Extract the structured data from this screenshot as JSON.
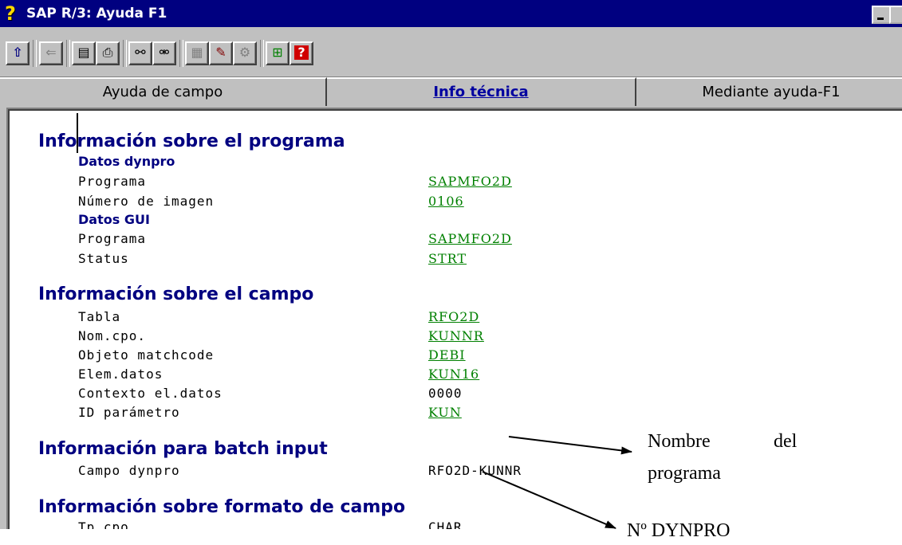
{
  "window": {
    "title": "SAP R/3: Ayuda F1"
  },
  "toolbar": {
    "buttons": [
      {
        "icon": "up-arrow-icon"
      },
      {
        "icon": "back-arrow-icon"
      },
      {
        "icon": "copy-icon"
      },
      {
        "icon": "print-icon"
      },
      {
        "icon": "find-icon"
      },
      {
        "icon": "find-next-icon"
      },
      {
        "icon": "paste-icon"
      },
      {
        "icon": "edit-icon"
      },
      {
        "icon": "settings-icon"
      },
      {
        "icon": "info-icon"
      },
      {
        "icon": "help-icon"
      }
    ]
  },
  "tabs": [
    {
      "label": "Ayuda de campo",
      "active": false
    },
    {
      "label": "Info técnica",
      "active": true
    },
    {
      "label": "Mediante ayuda-F1",
      "active": false
    }
  ],
  "program_info": {
    "title": "Información sobre el programa",
    "dynpro_title": "Datos dynpro",
    "programa_label": "Programa",
    "programa_value": "SAPMFO2D",
    "imagen_label": "Número de imagen",
    "imagen_value": "0106",
    "gui_title": "Datos GUI",
    "gui_programa_label": "Programa",
    "gui_programa_value": "SAPMFO2D",
    "status_label": "Status",
    "status_value": "STRT"
  },
  "field_info": {
    "title": "Información sobre el campo",
    "rows": [
      {
        "label": "Tabla",
        "value": "RFO2D"
      },
      {
        "label": "Nom.cpo.",
        "value": "KUNNR"
      },
      {
        "label": "Objeto matchcode",
        "value": "DEBI"
      },
      {
        "label": "Elem.datos",
        "value": "KUN16"
      },
      {
        "label": "Contexto el.datos",
        "value": "0000"
      },
      {
        "label": "ID parámetro",
        "value": "KUN"
      }
    ]
  },
  "batch_info": {
    "title": "Información para batch input",
    "campo_label": "Campo dynpro",
    "campo_value": "RFO2D-KUNNR"
  },
  "format_info": {
    "title": "Información sobre formato de campo",
    "tp_label": "Tp.cpo.",
    "tp_value": "CHAR"
  },
  "annotations": {
    "nombre_line1_a": "Nombre",
    "nombre_line1_b": "del",
    "nombre_line2": "programa",
    "dynpro": "Nº DYNPRO"
  }
}
